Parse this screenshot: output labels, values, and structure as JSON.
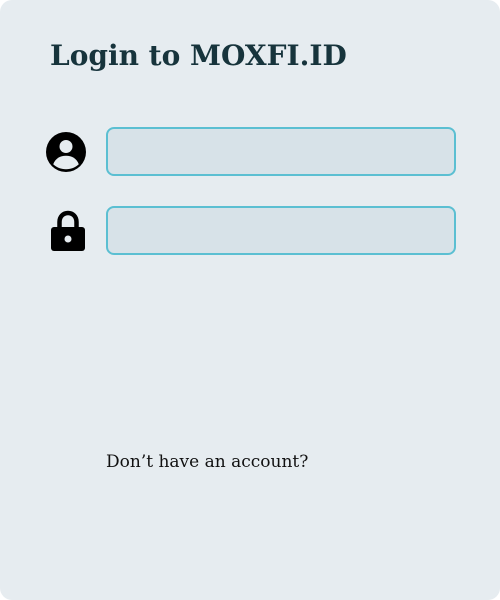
{
  "login_form": {
    "title": "Login to MOXFI.ID",
    "username": {
      "icon": "user-circle-icon",
      "value": "",
      "placeholder": ""
    },
    "password": {
      "icon": "lock-icon",
      "value": "",
      "placeholder": ""
    },
    "signup_prompt": "Don’t have an account?"
  },
  "colors": {
    "background": "#e6ecf0",
    "title": "#17343c",
    "field_border": "#5bbfd2",
    "field_fill": "#d7e2e8",
    "text": "#111111"
  }
}
